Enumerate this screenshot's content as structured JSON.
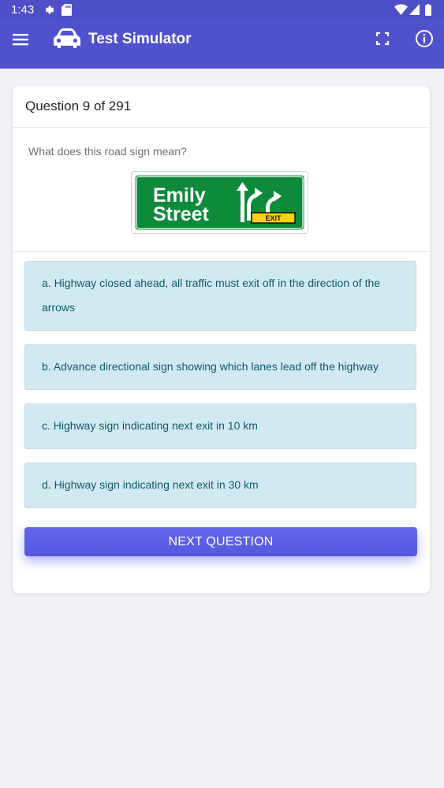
{
  "status_bar": {
    "time": "1:43",
    "icons": [
      "settings-icon",
      "sd-card-icon",
      "wifi-icon",
      "signal-icon",
      "battery-icon"
    ]
  },
  "app_bar": {
    "title": "Test Simulator",
    "icons": [
      "menu-icon",
      "car-icon",
      "fullscreen-icon",
      "info-icon"
    ],
    "color": "#5052cd"
  },
  "question": {
    "header": "Question 9 of 291",
    "prompt": "What does this road sign mean?",
    "sign": {
      "line1": "Emily",
      "line2": "Street",
      "exit_label": "EXIT",
      "background": "#0d8a3a"
    }
  },
  "answers": [
    {
      "text": "a. Highway closed ahead, all traffic must exit off in the direction of the arrows"
    },
    {
      "text": "b. Advance directional sign showing which lanes lead off the highway"
    },
    {
      "text": "c. Highway sign indicating next exit in 10 km"
    },
    {
      "text": "d. Highway sign indicating next exit in 30 km"
    }
  ],
  "actions": {
    "next_label": "NEXT QUESTION"
  }
}
